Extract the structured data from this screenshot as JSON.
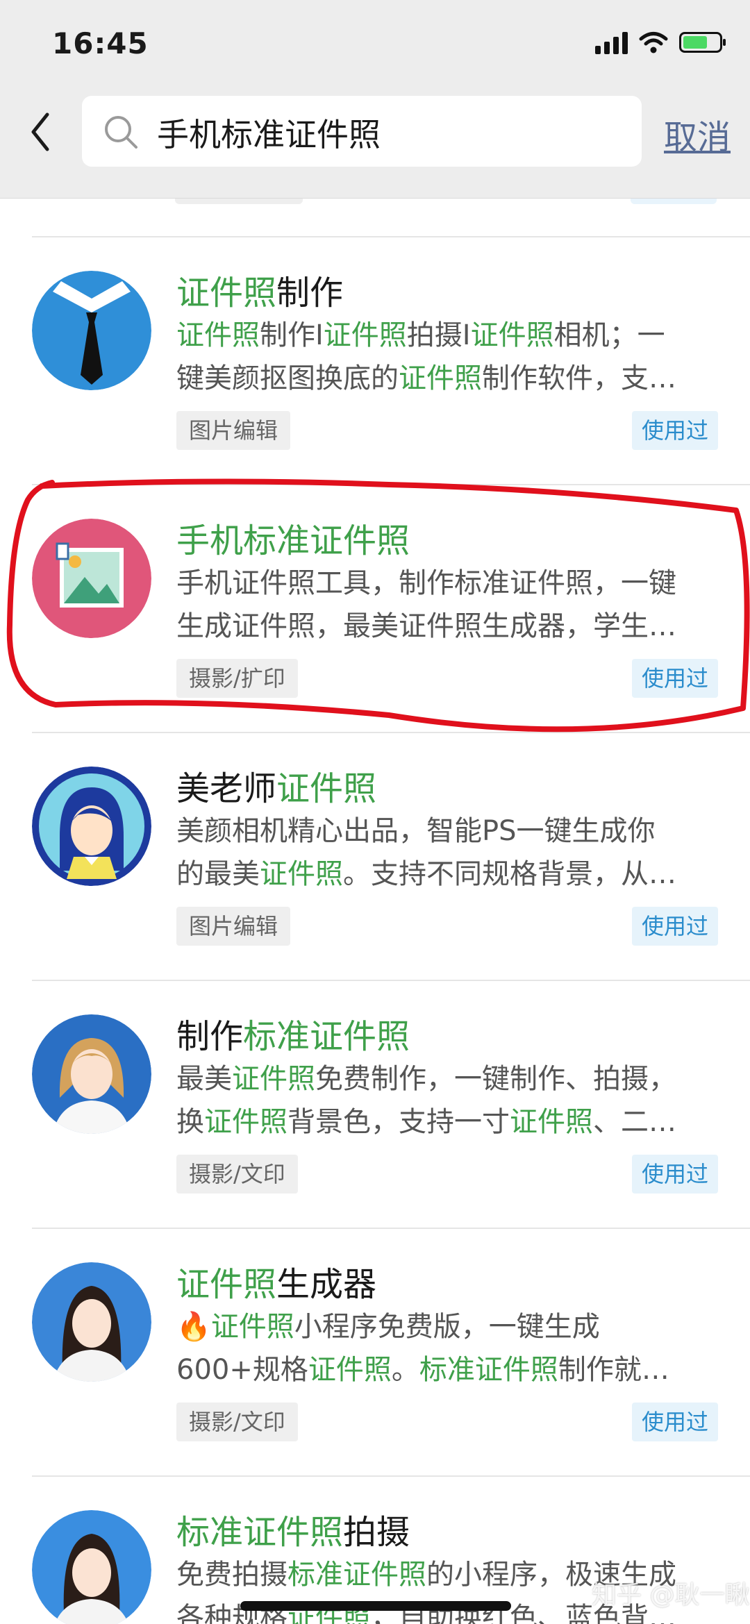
{
  "status_bar": {
    "time": "16:45"
  },
  "search": {
    "query": "手机标准证件照",
    "cancel_label": "取消"
  },
  "results": [
    {
      "title": [
        [
          "证件照",
          true
        ],
        [
          "制作",
          false
        ]
      ],
      "desc_lines": [
        [
          [
            "证件照",
            true
          ],
          [
            "制作I",
            false
          ],
          [
            "证件照",
            true
          ],
          [
            "拍摄I",
            false
          ],
          [
            "证件照",
            true
          ],
          [
            "相机；一",
            false
          ]
        ],
        [
          [
            "键美颜抠图换底的",
            false
          ],
          [
            "证件照",
            true
          ],
          [
            "制作软件，支…",
            false
          ]
        ]
      ],
      "category": "图片编辑",
      "used_label": "使用过"
    },
    {
      "title": [
        [
          "手机标准证件照",
          true
        ]
      ],
      "desc_lines": [
        [
          [
            "手机证件照工具，制作标准证件照，一键",
            false
          ]
        ],
        [
          [
            "生成证件照，最美证件照生成器，学生…",
            false
          ]
        ]
      ],
      "category": "摄影/扩印",
      "used_label": "使用过"
    },
    {
      "title": [
        [
          "美老师",
          false
        ],
        [
          "证件照",
          true
        ]
      ],
      "desc_lines": [
        [
          [
            "美颜相机精心出品，智能PS一键生成你",
            false
          ]
        ],
        [
          [
            "的最美",
            false
          ],
          [
            "证件照",
            true
          ],
          [
            "。支持不同规格背景，从…",
            false
          ]
        ]
      ],
      "category": "图片编辑",
      "used_label": "使用过"
    },
    {
      "title": [
        [
          "制作",
          false
        ],
        [
          "标准证件照",
          true
        ]
      ],
      "desc_lines": [
        [
          [
            "最美",
            false
          ],
          [
            "证件照",
            true
          ],
          [
            "免费制作，一键制作、拍摄，",
            false
          ]
        ],
        [
          [
            "换",
            false
          ],
          [
            "证件照",
            true
          ],
          [
            "背景色，支持一寸",
            false
          ],
          [
            "证件照",
            true
          ],
          [
            "、二…",
            false
          ]
        ]
      ],
      "category": "摄影/文印",
      "used_label": "使用过"
    },
    {
      "title": [
        [
          "证件照",
          true
        ],
        [
          "生成器",
          false
        ]
      ],
      "desc_lines": [
        [
          [
            "🔥",
            false
          ],
          [
            "证件照",
            true
          ],
          [
            "小程序免费版，一键生成",
            false
          ]
        ],
        [
          [
            "600+规格",
            false
          ],
          [
            "证件照",
            true
          ],
          [
            "。",
            false
          ],
          [
            "标准证件照",
            true
          ],
          [
            "制作就…",
            false
          ]
        ]
      ],
      "category": "摄影/文印",
      "used_label": "使用过"
    },
    {
      "title": [
        [
          "标准证件照",
          true
        ],
        [
          "拍摄",
          false
        ]
      ],
      "desc_lines": [
        [
          [
            "免费拍摄",
            false
          ],
          [
            "标准证件照",
            true
          ],
          [
            "的小程序，极速生成",
            false
          ]
        ],
        [
          [
            "各种规格",
            false
          ],
          [
            "证件照",
            true
          ],
          [
            "，自助换红色、蓝色背…",
            false
          ]
        ]
      ],
      "category": "",
      "used_label": ""
    }
  ],
  "watermark": "知乎 @耿一瞅",
  "colors": {
    "highlight": "#3fa04a",
    "cancel": "#576b95",
    "annotation": "#e0101c"
  }
}
